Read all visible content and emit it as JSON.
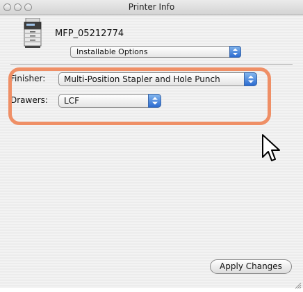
{
  "window": {
    "title": "Printer Info"
  },
  "printer": {
    "name": "MFP_05212774",
    "icon": "printer-copier-icon"
  },
  "section_popup": {
    "selected": "Installable Options"
  },
  "options": {
    "finisher": {
      "label": "Finisher:",
      "value": "Multi-Position Stapler and Hole Punch"
    },
    "drawers": {
      "label": "Drawers:",
      "value": "LCF"
    }
  },
  "actions": {
    "apply_label": "Apply Changes"
  },
  "colors": {
    "highlight": "#ef8f66",
    "popup_arrow": "#2c6bd0"
  }
}
